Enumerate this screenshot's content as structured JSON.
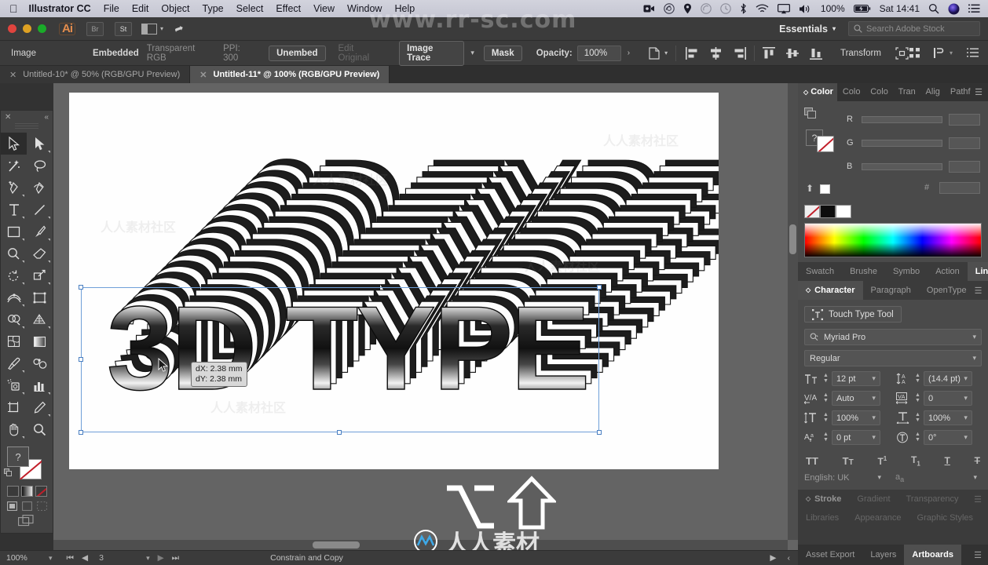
{
  "macbar": {
    "apple_icon": "apple-icon",
    "app_name": "Illustrator CC",
    "menus": [
      "File",
      "Edit",
      "Object",
      "Type",
      "Select",
      "Effect",
      "View",
      "Window",
      "Help"
    ],
    "status_icons": [
      "screen-record-icon",
      "creative-cloud-icon",
      "location-icon",
      "airdrop-icon",
      "timemachine-icon",
      "bluetooth-icon",
      "wifi-icon",
      "airplay-icon",
      "volume-icon"
    ],
    "battery_percent": "100%",
    "battery_icon": "battery-charging-icon",
    "clock": "Sat 14:41",
    "spotlight_icon": "search-icon",
    "siri_icon": "siri-icon",
    "notification_icon": "notification-center-icon"
  },
  "appbar": {
    "logo_text": "Ai",
    "bridge_label": "Br",
    "stock_label": "St",
    "arrange_icon": "arrange-documents-icon",
    "chevron_icon": "chevron-down-icon",
    "rocket_icon": "rocket-icon",
    "workspace_label": "Essentials",
    "workspace_chevron": "chevron-down-icon",
    "search_placeholder": "Search Adobe Stock",
    "search_icon": "search-icon"
  },
  "control_bar": {
    "object_type": "Image",
    "embed_state": "Embedded",
    "color_space": "Transparent RGB",
    "ppi": "PPI: 300",
    "unembed_label": "Unembed",
    "edit_original_label": "Edit Original",
    "image_trace_label": "Image Trace",
    "trace_chevron": "chevron-down-icon",
    "mask_label": "Mask",
    "opacity_label": "Opacity:",
    "opacity_value": "100%",
    "opacity_more": "chevron-right-icon",
    "recolor_icon": "recolor-artwork-icon",
    "align_left_icon": "align-left-icon",
    "align_hcenter_icon": "align-horizontal-center-icon",
    "align_right_icon": "align-right-icon",
    "align_top_icon": "align-top-icon",
    "align_vcenter_icon": "align-vertical-center-icon",
    "align_bottom_icon": "align-bottom-icon",
    "transform_label": "Transform",
    "isolate_icon": "isolate-selection-icon",
    "preferences_icon": "preferences-grid-icon",
    "doc_setup_icon": "document-setup-icon",
    "panel_menu_icon": "panel-menu-icon"
  },
  "document_tabs": [
    {
      "title": "Untitled-10* @ 50% (RGB/GPU Preview)",
      "active": false,
      "close_icon": "close-icon"
    },
    {
      "title": "Untitled-11* @ 100% (RGB/GPU Preview)",
      "active": true,
      "close_icon": "close-icon"
    }
  ],
  "toolbar": {
    "close_icon": "close-icon",
    "collapse_icon": "collapse-panel-icon",
    "tools": [
      {
        "name": "selection-tool",
        "selected": true,
        "flyout": false
      },
      {
        "name": "direct-selection-tool",
        "selected": false,
        "flyout": true
      },
      {
        "name": "magic-wand-tool",
        "selected": false,
        "flyout": false
      },
      {
        "name": "lasso-tool",
        "selected": false,
        "flyout": false
      },
      {
        "name": "pen-tool",
        "selected": false,
        "flyout": true
      },
      {
        "name": "curvature-tool",
        "selected": false,
        "flyout": false
      },
      {
        "name": "type-tool",
        "selected": false,
        "flyout": true
      },
      {
        "name": "line-segment-tool",
        "selected": false,
        "flyout": true
      },
      {
        "name": "rectangle-tool",
        "selected": false,
        "flyout": true
      },
      {
        "name": "paintbrush-tool",
        "selected": false,
        "flyout": true
      },
      {
        "name": "shaper-tool",
        "selected": false,
        "flyout": true
      },
      {
        "name": "eraser-tool",
        "selected": false,
        "flyout": true
      },
      {
        "name": "rotate-tool",
        "selected": false,
        "flyout": true
      },
      {
        "name": "scale-tool",
        "selected": false,
        "flyout": true
      },
      {
        "name": "width-tool",
        "selected": false,
        "flyout": true
      },
      {
        "name": "free-transform-tool",
        "selected": false,
        "flyout": false
      },
      {
        "name": "shape-builder-tool",
        "selected": false,
        "flyout": true
      },
      {
        "name": "perspective-grid-tool",
        "selected": false,
        "flyout": true
      },
      {
        "name": "mesh-tool",
        "selected": false,
        "flyout": false
      },
      {
        "name": "gradient-tool",
        "selected": false,
        "flyout": false
      },
      {
        "name": "eyedropper-tool",
        "selected": false,
        "flyout": true
      },
      {
        "name": "blend-tool",
        "selected": false,
        "flyout": false
      },
      {
        "name": "symbol-sprayer-tool",
        "selected": false,
        "flyout": true
      },
      {
        "name": "column-graph-tool",
        "selected": false,
        "flyout": true
      },
      {
        "name": "artboard-tool",
        "selected": false,
        "flyout": false
      },
      {
        "name": "slice-tool",
        "selected": false,
        "flyout": true
      },
      {
        "name": "hand-tool",
        "selected": false,
        "flyout": true
      },
      {
        "name": "zoom-tool",
        "selected": false,
        "flyout": false
      }
    ],
    "fill_label": "?",
    "stroke_none_icon": "none-swatch-icon",
    "swap_icon": "swap-fill-stroke-icon",
    "color_mode_icons": [
      "color-swatch-icon",
      "gradient-swatch-icon",
      "none-swatch-icon"
    ],
    "screen_mode_icons": [
      "normal-screen-mode-icon",
      "full-screen-menu-icon",
      "full-screen-icon"
    ],
    "draw_mode_icon": "draw-normal-icon"
  },
  "canvas": {
    "artwork_text": "3D TYPE",
    "tooltip": {
      "dx": "dX: 2.38 mm",
      "dy": "dY: 2.38 mm"
    },
    "key_overlay": [
      "option-key-icon",
      "shift-key-icon"
    ]
  },
  "watermarks": {
    "top": "www.rr-sc.com",
    "tile": "人人素材社区",
    "logo": "人人素材"
  },
  "right_dock": {
    "color_group": {
      "tabs": [
        "Color",
        "Colo",
        "Colo",
        "Tran",
        "Alig",
        "Pathf"
      ],
      "active_tab": "Color",
      "menu_icon": "panel-menu-icon",
      "fill_stroke_icon": "fill-stroke-indicator",
      "none_icon": "none-swatch-icon",
      "unknown_label": "?",
      "channels": [
        "R",
        "G",
        "B"
      ],
      "hex_label": "#",
      "hex_value": "",
      "swatches": [
        "none-swatch",
        "black-swatch",
        "white-swatch"
      ],
      "reset_icon": "return-arrow-icon"
    },
    "library_tabs": {
      "tabs": [
        "Swatch",
        "Brushe",
        "Symbo",
        "Action",
        "Links"
      ],
      "active_tab": "Links",
      "menu_icon": "panel-menu-icon"
    },
    "type_tabs": {
      "tabs": [
        "Character",
        "Paragraph",
        "OpenType"
      ],
      "active_tab": "Character",
      "menu_icon": "panel-menu-icon"
    },
    "character": {
      "touch_type_label": "Touch Type Tool",
      "touch_type_icon": "touch-type-tool-icon",
      "font_family": "Myriad Pro",
      "font_search_icon": "font-search-icon",
      "font_style": "Regular",
      "font_size_icon": "font-size-icon",
      "font_size": "12 pt",
      "leading_icon": "leading-icon",
      "leading": "(14.4 pt)",
      "kerning_icon": "kerning-icon",
      "kerning": "Auto",
      "tracking_icon": "tracking-icon",
      "tracking": "0",
      "vscale_icon": "vertical-scale-icon",
      "vertical_scale": "100%",
      "hscale_icon": "horizontal-scale-icon",
      "horizontal_scale": "100%",
      "baseline_icon": "baseline-shift-icon",
      "baseline_shift": "0 pt",
      "rotation_icon": "character-rotation-icon",
      "character_rotation": "0°",
      "style_buttons": [
        "all-caps-icon",
        "small-caps-icon",
        "superscript-icon",
        "subscript-icon",
        "underline-icon",
        "strikethrough-icon"
      ],
      "language": "English: UK",
      "antialias_icon": "anti-aliasing-icon"
    },
    "appearance_tabs": {
      "tabs": [
        "Stroke",
        "Gradient",
        "Transparency"
      ],
      "active_tab": "Stroke",
      "menu_icon": "panel-menu-icon"
    },
    "libraries_tabs": {
      "tabs": [
        "Libraries",
        "Appearance",
        "Graphic Styles"
      ],
      "active_tab": "Libraries",
      "menu_icon": "panel-menu-icon"
    },
    "bottom_tabs": {
      "tabs": [
        "Asset Export",
        "Layers",
        "Artboards"
      ],
      "active_tab": "Artboards",
      "menu_icon": "panel-menu-icon"
    }
  },
  "status_bar": {
    "zoom": "100%",
    "zoom_chevron": "chevron-down-icon",
    "first_icon": "first-artboard-icon",
    "prev_icon": "previous-artboard-icon",
    "artboard_number": "3",
    "artboard_chevron": "chevron-down-icon",
    "next_icon": "next-artboard-icon",
    "last_icon": "last-artboard-icon",
    "status_text": "Constrain and Copy",
    "status_arrow": "play-arrow-icon",
    "resize_icon": "resize-grip-icon"
  }
}
